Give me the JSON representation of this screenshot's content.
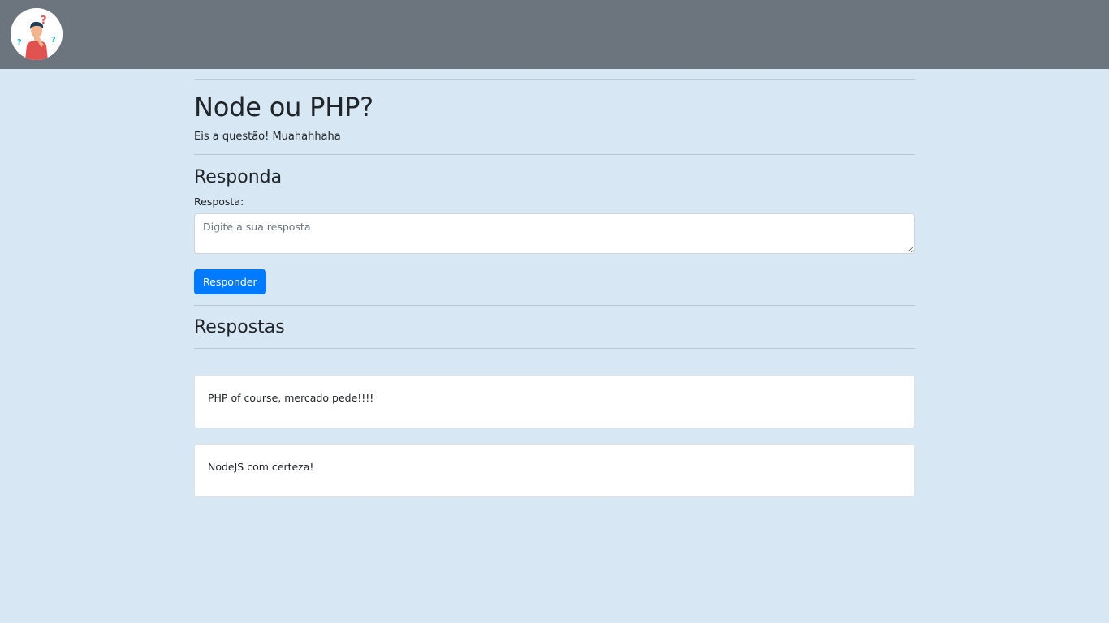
{
  "header": {
    "logo_icon": "confused-person-question-marks-icon",
    "background_color": "#6c757d"
  },
  "question": {
    "title": "Node ou PHP?",
    "description": "Eis a questão! Muahahhaha"
  },
  "answer_form": {
    "section_title": "Responda",
    "label": "Resposta:",
    "placeholder": "Digite a sua resposta",
    "value": "",
    "submit_label": "Responder",
    "submit_color": "#007bff"
  },
  "answers": {
    "section_title": "Respostas",
    "items": [
      {
        "text": "PHP of course, mercado pede!!!!"
      },
      {
        "text": "NodeJS com certeza!"
      }
    ]
  },
  "page_background": "#d7e8f4"
}
